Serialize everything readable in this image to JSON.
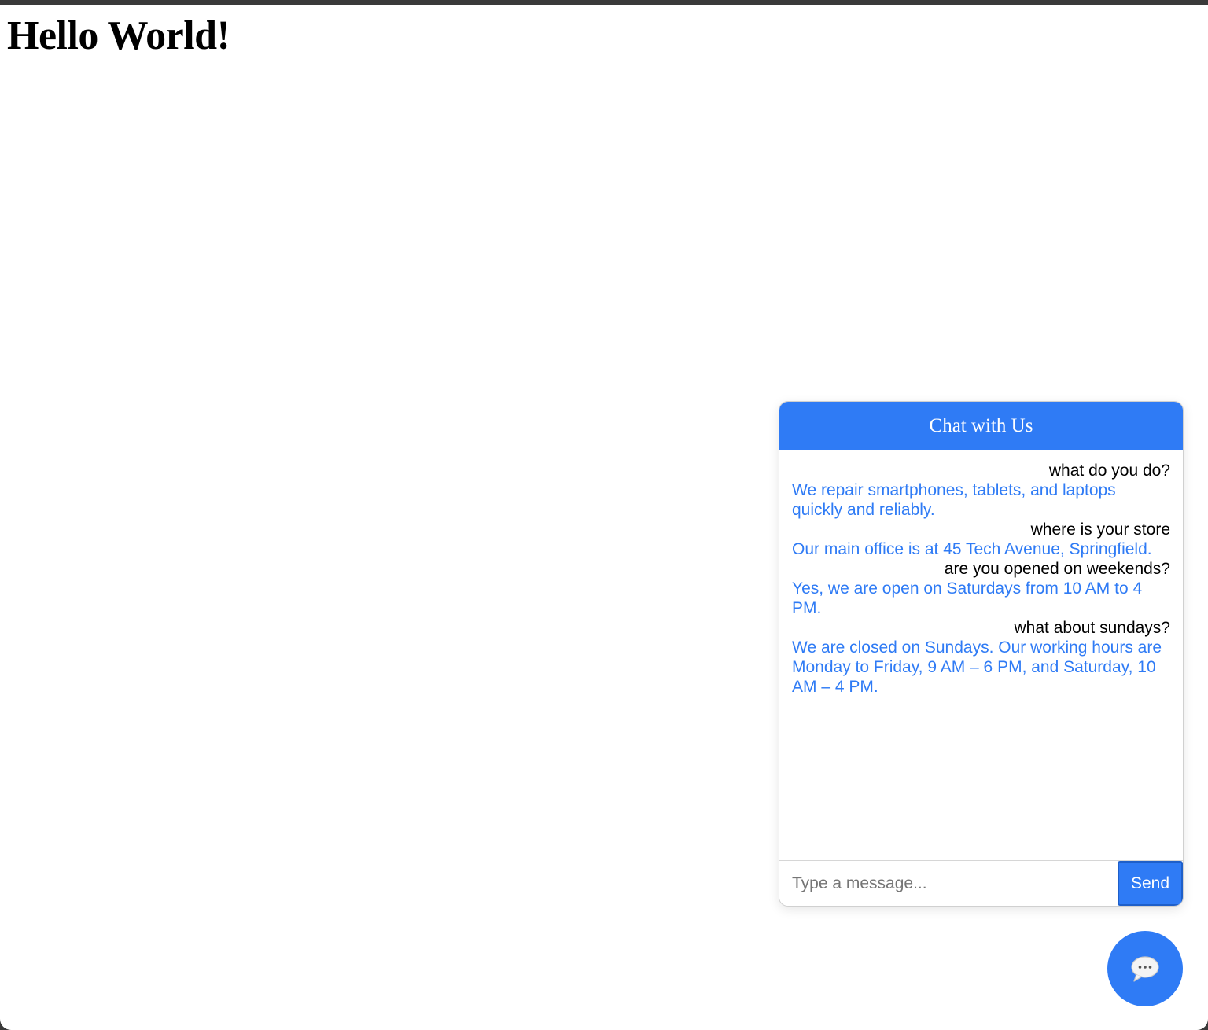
{
  "page": {
    "title": "Hello World!"
  },
  "chat": {
    "header_title": "Chat with Us",
    "messages": [
      {
        "sender": "user",
        "text": "what do you do?"
      },
      {
        "sender": "bot",
        "text": "We repair smartphones, tablets, and laptops quickly and reliably."
      },
      {
        "sender": "user",
        "text": "where is your store"
      },
      {
        "sender": "bot",
        "text": "Our main office is at 45 Tech Avenue, Springfield."
      },
      {
        "sender": "user",
        "text": "are you opened on weekends?"
      },
      {
        "sender": "bot",
        "text": "Yes, we are open on Saturdays from 10 AM to 4 PM."
      },
      {
        "sender": "user",
        "text": "what about sundays?"
      },
      {
        "sender": "bot",
        "text": "We are closed on Sundays. Our working hours are Monday to Friday, 9 AM – 6 PM, and Saturday, 10 AM – 4 PM."
      }
    ],
    "input": {
      "value": "",
      "placeholder": "Type a message..."
    },
    "send_label": "Send",
    "toggle_icon": "chat-bubble-icon"
  },
  "colors": {
    "accent": "#2f7bf5",
    "user_text": "#000000",
    "bot_text": "#2f7bf5"
  }
}
